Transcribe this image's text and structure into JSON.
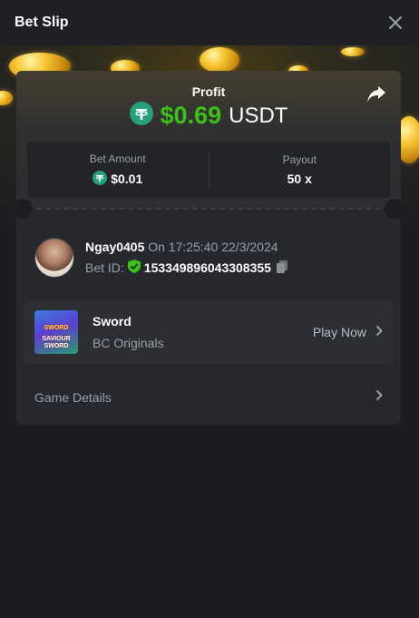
{
  "header": {
    "title": "Bet Slip",
    "close_icon": "close-icon"
  },
  "profit": {
    "label": "Profit",
    "value": "$0.69",
    "currency": "USDT",
    "token_icon": "tether-icon",
    "share_icon": "share-icon",
    "color": "#3bc117"
  },
  "stats": {
    "bet_amount_label": "Bet Amount",
    "bet_amount_value": "$0.01",
    "payout_label": "Payout",
    "payout_value": "50 x"
  },
  "bet": {
    "username": "Ngay0405",
    "time_text": "On 17:25:40 22/3/2024",
    "bet_id_label": "Bet ID:",
    "bet_id": "153349896043308355",
    "verified_icon": "shield-check-icon",
    "copy_icon": "copy-icon"
  },
  "game": {
    "name": "Sword",
    "provider": "BC Originals",
    "play_label": "Play Now",
    "thumb_text_1": "SWORD",
    "thumb_text_2": "SAVIOUR",
    "thumb_text_3": "SWORD"
  },
  "details": {
    "label": "Game Details"
  }
}
